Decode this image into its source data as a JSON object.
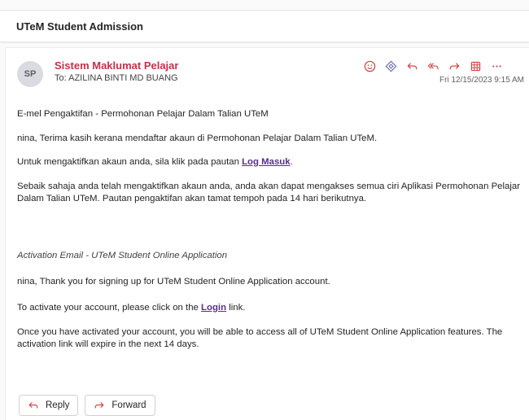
{
  "subject": "UTeM Student Admission",
  "message": {
    "avatar_initials": "SP",
    "sender": "Sistem Maklumat Pelajar",
    "to_line": "To:  AZILINA BINTI MD BUANG",
    "timestamp": "Fri 12/15/2023 9:15 AM",
    "toolbar_icons": [
      "smile-icon",
      "immersive-reader-icon",
      "reply-icon",
      "reply-all-icon",
      "forward-icon",
      "apps-icon",
      "more-icon"
    ],
    "accent_color": "#c4314b",
    "icon_color": "#d13438"
  },
  "body": {
    "malay_heading": "E-mel Pengaktifan - Permohonan Pelajar Dalam Talian UTeM",
    "malay_thanks": "nina, Terima kasih kerana mendaftar akaun di Permohonan Pelajar Dalam Talian UTeM.",
    "malay_activate_prefix": "Untuk mengaktifkan akaun anda, sila klik pada pautan ",
    "malay_activate_link": "Log Masuk",
    "malay_activate_suffix": ".",
    "malay_info": "Sebaik sahaja anda telah mengaktifkan akaun anda, anda akan dapat mengakses semua ciri Aplikasi Permohonan Pelajar Dalam Talian UTeM. Pautan pengaktifan akan tamat tempoh pada 14 hari berikutnya.",
    "english_heading": "Activation Email - UTeM Student Online Application",
    "english_thanks": "nina, Thank you for signing up for UTeM Student Online Application account.",
    "english_activate_prefix": "To activate your account, please click on the ",
    "english_activate_link": "Login",
    "english_activate_suffix": " link.",
    "english_info": "Once you have activated your account, you will be able to access all of UTeM Student Online Application features. The activation link will expire in the next 14 days.",
    "link_color": "#5b2c8f"
  },
  "actions": {
    "reply_label": "Reply",
    "forward_label": "Forward"
  }
}
